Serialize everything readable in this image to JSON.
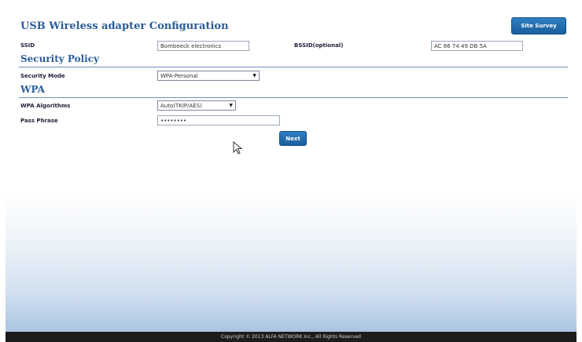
{
  "header": {
    "title": "USB Wireless adapter Configuration",
    "site_survey_label": "Site Survey"
  },
  "ssid": {
    "label": "SSID",
    "value": "Bombeeck electronics"
  },
  "bssid": {
    "label": "BSSID(optional)",
    "value": "AC 86 74 49 DB 5A"
  },
  "security_policy": {
    "heading": "Security Policy",
    "mode_label": "Security Mode",
    "mode_value": "WPA-Personal"
  },
  "wpa": {
    "heading": "WPA",
    "algorithm_label": "WPA Algorithms",
    "algorithm_value": "Auto(TKIP/AES)",
    "passphrase_label": "Pass Phrase",
    "passphrase_value": "••••••••"
  },
  "actions": {
    "next_label": "Next"
  },
  "footer": {
    "copyright": "Copyright © 2013 ALFA NETWORK Inc., All Rights Reserved"
  },
  "icons": {
    "cursor": "mouse-pointer-icon",
    "dropdown": "chevron-down-icon"
  },
  "colors": {
    "accent": "#2c5d9a",
    "button": "#1b5e9c",
    "footer": "#1c1c1c"
  }
}
